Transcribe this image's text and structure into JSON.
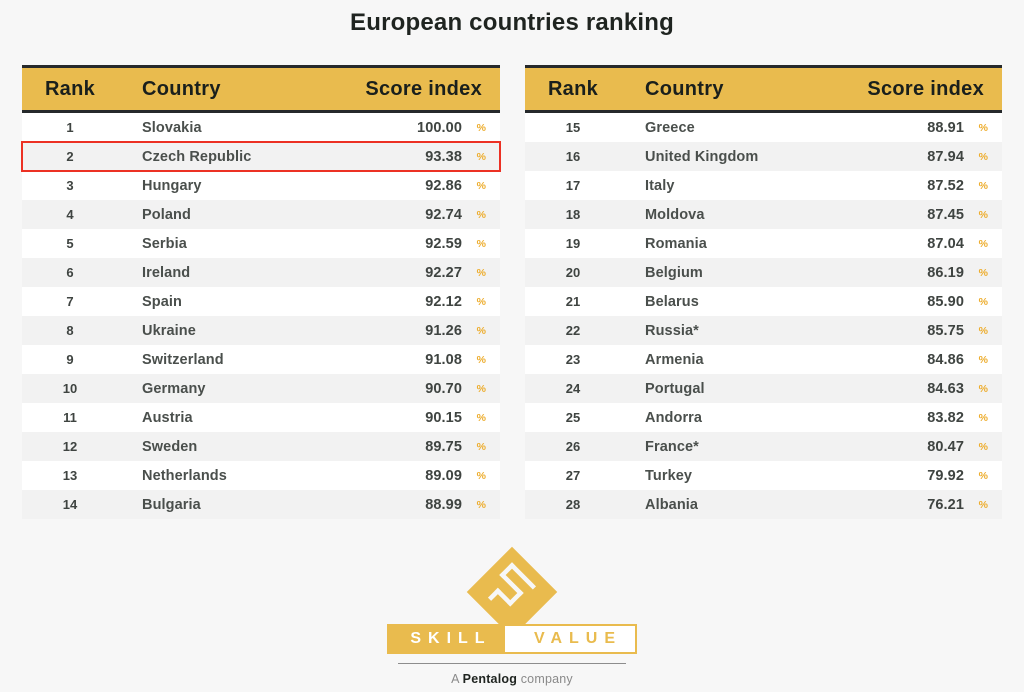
{
  "page": {
    "title": "European countries ranking",
    "background_color": "#f7f7f7",
    "accent_color": "#e9bb4e",
    "highlight_color": "#ec3124",
    "percent_symbol": "%"
  },
  "tables": {
    "headers": {
      "rank": "Rank",
      "country": "Country",
      "score": "Score index"
    },
    "left_rows": [
      {
        "rank": "1",
        "country": "Slovakia",
        "score": "100.00",
        "highlighted": false
      },
      {
        "rank": "2",
        "country": "Czech Republic",
        "score": "93.38",
        "highlighted": true
      },
      {
        "rank": "3",
        "country": "Hungary",
        "score": "92.86",
        "highlighted": false
      },
      {
        "rank": "4",
        "country": "Poland",
        "score": "92.74",
        "highlighted": false
      },
      {
        "rank": "5",
        "country": "Serbia",
        "score": "92.59",
        "highlighted": false
      },
      {
        "rank": "6",
        "country": "Ireland",
        "score": "92.27",
        "highlighted": false
      },
      {
        "rank": "7",
        "country": "Spain",
        "score": "92.12",
        "highlighted": false
      },
      {
        "rank": "8",
        "country": "Ukraine",
        "score": "91.26",
        "highlighted": false
      },
      {
        "rank": "9",
        "country": "Switzerland",
        "score": "91.08",
        "highlighted": false
      },
      {
        "rank": "10",
        "country": "Germany",
        "score": "90.70",
        "highlighted": false
      },
      {
        "rank": "11",
        "country": "Austria",
        "score": "90.15",
        "highlighted": false
      },
      {
        "rank": "12",
        "country": "Sweden",
        "score": "89.75",
        "highlighted": false
      },
      {
        "rank": "13",
        "country": "Netherlands",
        "score": "89.09",
        "highlighted": false
      },
      {
        "rank": "14",
        "country": "Bulgaria",
        "score": "88.99",
        "highlighted": false
      }
    ],
    "right_rows": [
      {
        "rank": "15",
        "country": "Greece",
        "score": "88.91",
        "highlighted": false
      },
      {
        "rank": "16",
        "country": "United Kingdom",
        "score": "87.94",
        "highlighted": false
      },
      {
        "rank": "17",
        "country": "Italy",
        "score": "87.52",
        "highlighted": false
      },
      {
        "rank": "18",
        "country": "Moldova",
        "score": "87.45",
        "highlighted": false
      },
      {
        "rank": "19",
        "country": "Romania",
        "score": "87.04",
        "highlighted": false
      },
      {
        "rank": "20",
        "country": "Belgium",
        "score": "86.19",
        "highlighted": false
      },
      {
        "rank": "21",
        "country": "Belarus",
        "score": "85.90",
        "highlighted": false
      },
      {
        "rank": "22",
        "country": "Russia*",
        "score": "85.75",
        "highlighted": false
      },
      {
        "rank": "23",
        "country": "Armenia",
        "score": "84.86",
        "highlighted": false
      },
      {
        "rank": "24",
        "country": "Portugal",
        "score": "84.63",
        "highlighted": false
      },
      {
        "rank": "25",
        "country": "Andorra",
        "score": "83.82",
        "highlighted": false
      },
      {
        "rank": "26",
        "country": "France*",
        "score": "80.47",
        "highlighted": false
      },
      {
        "rank": "27",
        "country": "Turkey",
        "score": "79.92",
        "highlighted": false
      },
      {
        "rank": "28",
        "country": "Albania",
        "score": "76.21",
        "highlighted": false
      }
    ]
  },
  "logo": {
    "mark_name": "skillvalue-diamond-logo",
    "word_primary": "SKILL",
    "word_secondary": "VALUE",
    "tagline_prefix": "A ",
    "tagline_brand": "Pentalog",
    "tagline_suffix": " company"
  },
  "chart_data": {
    "type": "table",
    "title": "European countries ranking",
    "columns": [
      "Rank",
      "Country",
      "Score index"
    ],
    "unit": "%",
    "categories": [
      "Slovakia",
      "Czech Republic",
      "Hungary",
      "Poland",
      "Serbia",
      "Ireland",
      "Spain",
      "Ukraine",
      "Switzerland",
      "Germany",
      "Austria",
      "Sweden",
      "Netherlands",
      "Bulgaria",
      "Greece",
      "United Kingdom",
      "Italy",
      "Moldova",
      "Romania",
      "Belgium",
      "Belarus",
      "Russia*",
      "Armenia",
      "Portugal",
      "Andorra",
      "France*",
      "Turkey",
      "Albania"
    ],
    "values": [
      100.0,
      93.38,
      92.86,
      92.74,
      92.59,
      92.27,
      92.12,
      91.26,
      91.08,
      90.7,
      90.15,
      89.75,
      89.09,
      88.99,
      88.91,
      87.94,
      87.52,
      87.45,
      87.04,
      86.19,
      85.9,
      85.75,
      84.86,
      84.63,
      83.82,
      80.47,
      79.92,
      76.21
    ],
    "ranks": [
      1,
      2,
      3,
      4,
      5,
      6,
      7,
      8,
      9,
      10,
      11,
      12,
      13,
      14,
      15,
      16,
      17,
      18,
      19,
      20,
      21,
      22,
      23,
      24,
      25,
      26,
      27,
      28
    ],
    "highlighted_category": "Czech Republic",
    "ylabel": "Score index",
    "xlabel": "Country",
    "ylim": [
      76.21,
      100.0
    ]
  }
}
